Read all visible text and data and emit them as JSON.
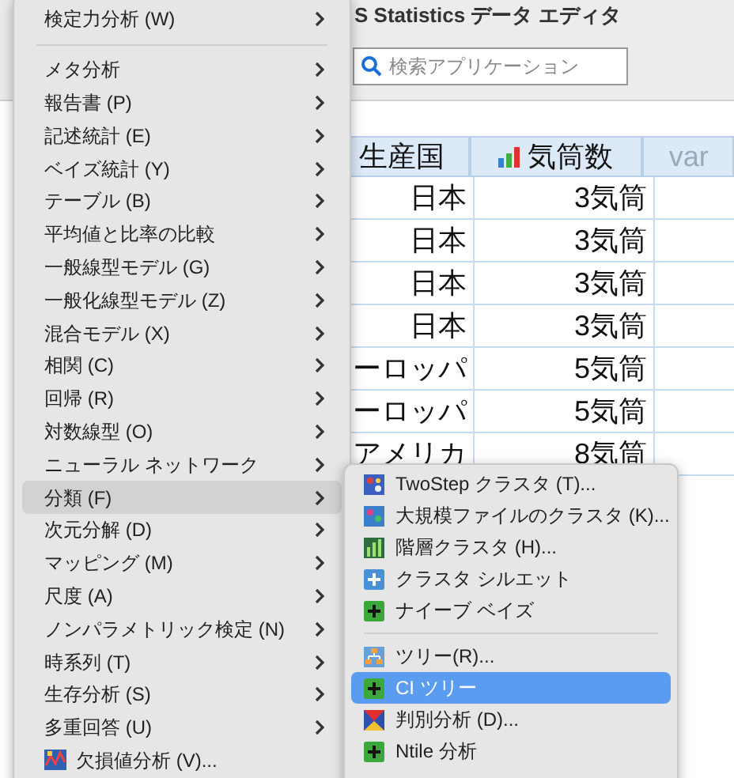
{
  "window": {
    "title": "S Statistics データ エディタ"
  },
  "search": {
    "placeholder": "検索アプリケーション"
  },
  "table": {
    "columns": [
      {
        "label": "生産国",
        "kind": "variable"
      },
      {
        "label": "気筒数",
        "kind": "variable"
      },
      {
        "label": "var",
        "kind": "empty"
      }
    ],
    "rows": [
      [
        "日本",
        "3気筒"
      ],
      [
        "日本",
        "3気筒"
      ],
      [
        "日本",
        "3気筒"
      ],
      [
        "日本",
        "3気筒"
      ],
      [
        "ーロッパ",
        "5気筒"
      ],
      [
        "ーロッパ",
        "5気筒"
      ],
      [
        "アメリカ",
        "8気筒"
      ]
    ]
  },
  "menu": {
    "groups": [
      [
        {
          "label": "検定力分析 (W)",
          "submenu": true,
          "selected": false
        }
      ],
      [
        {
          "label": "メタ分析",
          "submenu": true,
          "selected": false
        },
        {
          "label": "報告書 (P)",
          "submenu": true,
          "selected": false
        },
        {
          "label": "記述統計 (E)",
          "submenu": true,
          "selected": false
        },
        {
          "label": "ベイズ統計 (Y)",
          "submenu": true,
          "selected": false
        },
        {
          "label": "テーブル (B)",
          "submenu": true,
          "selected": false
        },
        {
          "label": "平均値と比率の比較",
          "submenu": true,
          "selected": false
        },
        {
          "label": "一般線型モデル (G)",
          "submenu": true,
          "selected": false
        },
        {
          "label": "一般化線型モデル (Z)",
          "submenu": true,
          "selected": false
        },
        {
          "label": "混合モデル (X)",
          "submenu": true,
          "selected": false
        },
        {
          "label": "相関 (C)",
          "submenu": true,
          "selected": false
        },
        {
          "label": "回帰 (R)",
          "submenu": true,
          "selected": false
        },
        {
          "label": "対数線型 (O)",
          "submenu": true,
          "selected": false
        },
        {
          "label": "ニューラル ネットワーク",
          "submenu": true,
          "selected": false
        },
        {
          "label": "分類 (F)",
          "submenu": true,
          "selected": true
        },
        {
          "label": "次元分解 (D)",
          "submenu": true,
          "selected": false
        },
        {
          "label": "マッピング (M)",
          "submenu": true,
          "selected": false
        },
        {
          "label": "尺度 (A)",
          "submenu": true,
          "selected": false
        },
        {
          "label": "ノンパラメトリック検定 (N)",
          "submenu": true,
          "selected": false
        },
        {
          "label": "時系列 (T)",
          "submenu": true,
          "selected": false
        },
        {
          "label": "生存分析 (S)",
          "submenu": true,
          "selected": false
        },
        {
          "label": "多重回答 (U)",
          "submenu": true,
          "selected": false
        },
        {
          "label": "欠損値分析 (V)...",
          "submenu": false,
          "selected": false
        }
      ]
    ]
  },
  "submenu": {
    "groups": [
      [
        {
          "label": "TwoStep クラスタ (T)...",
          "selected": false
        },
        {
          "label": "大規模ファイルのクラスタ (K)...",
          "selected": false
        },
        {
          "label": "階層クラスタ (H)...",
          "selected": false
        },
        {
          "label": "クラスタ シルエット",
          "selected": false
        },
        {
          "label": "ナイーブ ベイズ",
          "selected": false
        }
      ],
      [
        {
          "label": "ツリー(R)...",
          "selected": false
        },
        {
          "label": "CI ツリー",
          "selected": true
        },
        {
          "label": "判別分析 (D)...",
          "selected": false
        },
        {
          "label": "Ntile 分析",
          "selected": false
        }
      ]
    ]
  }
}
